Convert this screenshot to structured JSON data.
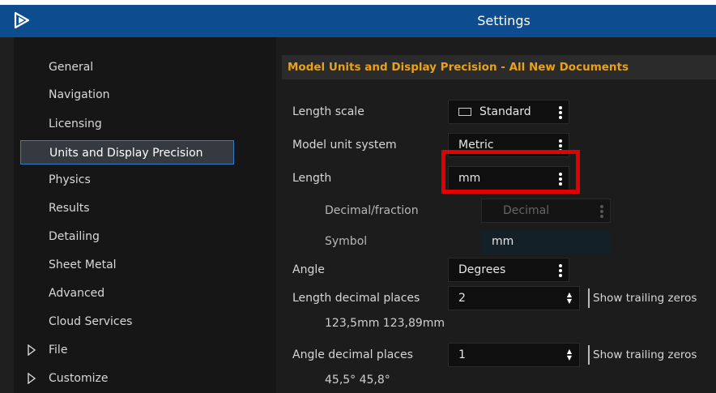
{
  "window": {
    "title": "Settings"
  },
  "sidebar": {
    "items": [
      {
        "label": "General"
      },
      {
        "label": "Navigation"
      },
      {
        "label": "Licensing"
      },
      {
        "label": "Units and Display Precision"
      },
      {
        "label": "Physics"
      },
      {
        "label": "Results"
      },
      {
        "label": "Detailing"
      },
      {
        "label": "Sheet Metal"
      },
      {
        "label": "Advanced"
      },
      {
        "label": "Cloud Services"
      },
      {
        "label": "File"
      },
      {
        "label": "Customize"
      }
    ],
    "active_index": 3
  },
  "section": {
    "title": "Model Units and Display Precision - All New Documents"
  },
  "fields": {
    "length_scale": {
      "label": "Length scale",
      "value": "Standard",
      "icon": "ruler-icon"
    },
    "model_unit_system": {
      "label": "Model unit system",
      "value": "Metric"
    },
    "length": {
      "label": "Length",
      "value": "mm"
    },
    "decimal_fraction": {
      "label": "Decimal/fraction",
      "value": "Decimal"
    },
    "symbol": {
      "label": "Symbol",
      "value": "mm"
    },
    "angle": {
      "label": "Angle",
      "value": "Degrees"
    },
    "length_decimal_places": {
      "label": "Length decimal places",
      "value": "2",
      "checkbox_label": "Show trailing zeros",
      "example": "123,5mm   123,89mm"
    },
    "angle_decimal_places": {
      "label": "Angle decimal places",
      "value": "1",
      "checkbox_label": "Show trailing zeros",
      "example": "45,5°   45,8°"
    }
  },
  "colors": {
    "title_bar": "#0c4c8f",
    "section_header_text": "#e8a11c",
    "highlight": "#e20000"
  }
}
